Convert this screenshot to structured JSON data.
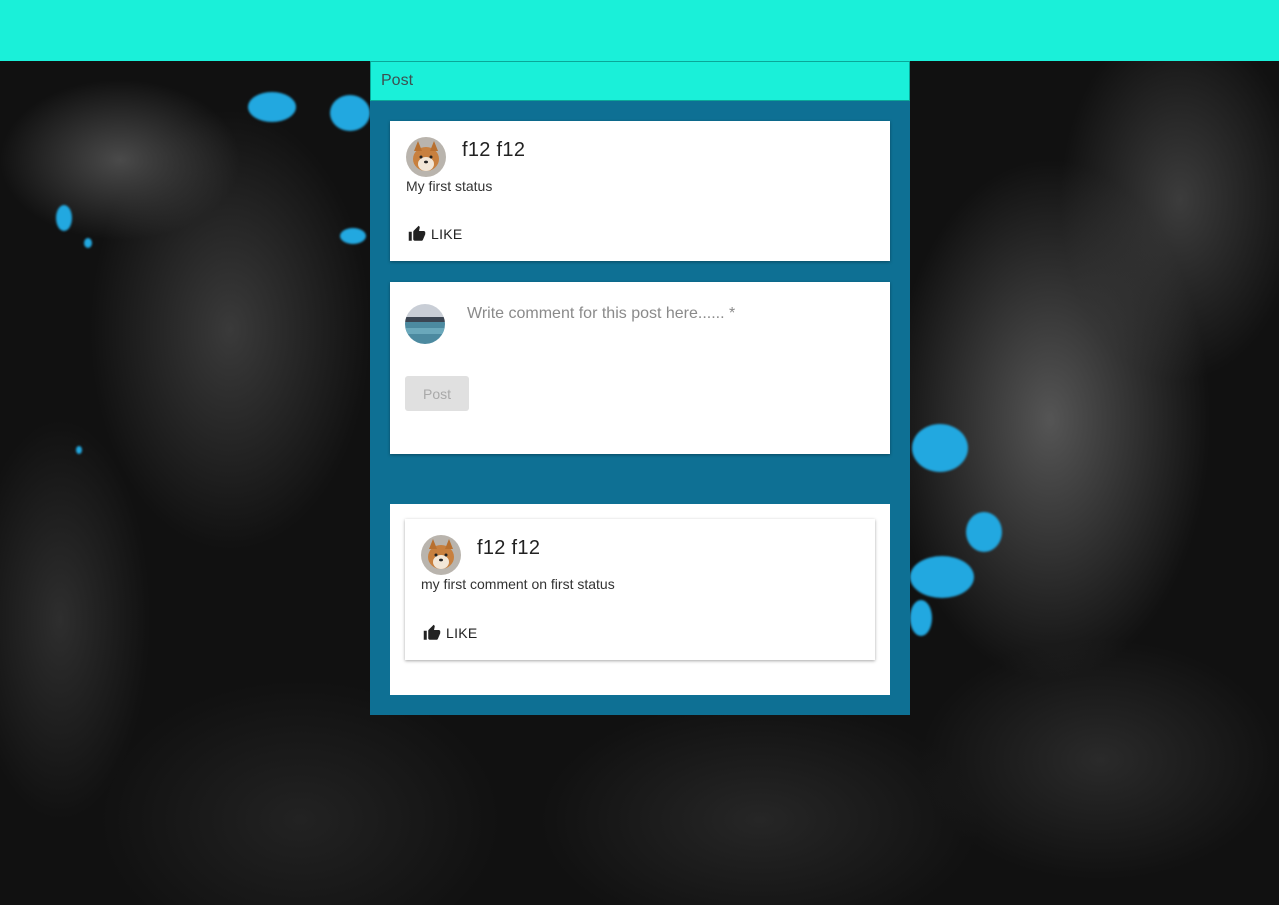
{
  "colors": {
    "topbar": "#1af0d9",
    "panel": "#0e7094",
    "accent_blue": "#22a8e0"
  },
  "panel": {
    "title": "Post"
  },
  "status": {
    "author": "f12 f12",
    "text": "My first status",
    "like_label": "LIKE",
    "avatar_icon": "shiba-dog-avatar"
  },
  "comment_form": {
    "placeholder": "Write comment for this post here...... *",
    "value": "",
    "post_label": "Post",
    "avatar_icon": "lake-landscape-avatar"
  },
  "comments": [
    {
      "author": "f12 f12",
      "text": "my first comment on first status",
      "like_label": "LIKE",
      "avatar_icon": "shiba-dog-avatar"
    }
  ]
}
